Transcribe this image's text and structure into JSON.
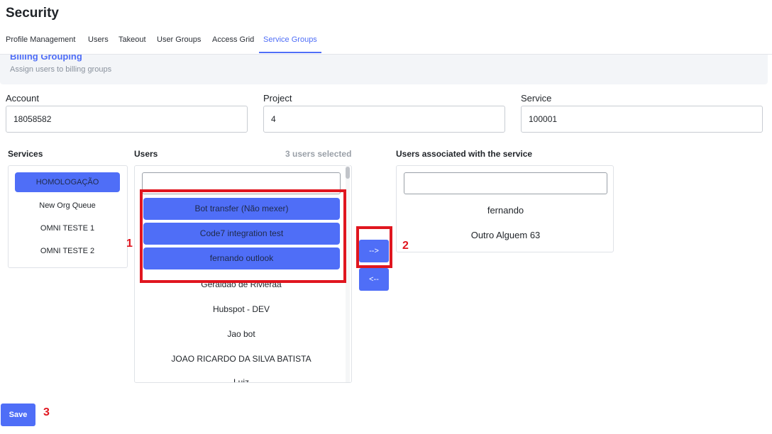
{
  "page": {
    "title": "Security"
  },
  "tabs": [
    "Profile Management",
    "Users",
    "Takeout",
    "User Groups",
    "Access Grid",
    "Service Groups"
  ],
  "banner": {
    "title": "Billing Grouping",
    "subtitle": "Assign users to billing groups"
  },
  "fields": {
    "account": {
      "label": "Account",
      "value": "18058582"
    },
    "project": {
      "label": "Project",
      "value": "4"
    },
    "service": {
      "label": "Service",
      "value": "100001"
    }
  },
  "services": {
    "label": "Services",
    "items": [
      "HOMOLOGAÇÃO",
      "New Org Queue",
      "OMNI TESTE 1",
      "OMNI TESTE 2"
    ],
    "selected": "HOMOLOGAÇÃO"
  },
  "users": {
    "label": "Users",
    "selected_count": "3 users selected",
    "search_value": "",
    "items": [
      "Bot transfer (Não mexer)",
      "Code7 integration test",
      "fernando outlook",
      "Geraldao de Rivieraa",
      "Hubspot - DEV",
      "Jao bot",
      "JOAO RICARDO DA SILVA BATISTA",
      "Luiz"
    ]
  },
  "associated": {
    "label": "Users associated with the service",
    "search_value": "",
    "items": [
      "fernando",
      "Outro Alguem 63"
    ]
  },
  "buttons": {
    "add": "-->",
    "remove": "<--",
    "save": "Save"
  },
  "annotations": {
    "one": "1",
    "two": "2",
    "three": "3",
    "color": "#e0161f"
  },
  "colors": {
    "accent": "#4f6ef7"
  }
}
